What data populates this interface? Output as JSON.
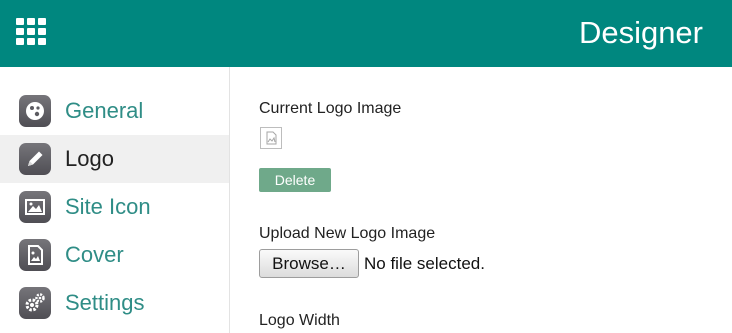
{
  "header": {
    "title": "Designer",
    "menu_icon": "grid-apps-icon",
    "color": "#00877f"
  },
  "sidebar": {
    "items": [
      {
        "label": "General",
        "icon": "palette-icon"
      },
      {
        "label": "Logo",
        "icon": "pencil-icon",
        "active": true
      },
      {
        "label": "Site Icon",
        "icon": "image-icon"
      },
      {
        "label": "Cover",
        "icon": "document-image-icon"
      },
      {
        "label": "Settings",
        "icon": "gears-icon"
      }
    ],
    "link_color": "#2f8d86"
  },
  "main": {
    "current_logo_label": "Current Logo Image",
    "delete_label": "Delete",
    "upload_label": "Upload New Logo Image",
    "browse_label": "Browse…",
    "file_status": "No file selected.",
    "logo_width_label": "Logo Width"
  }
}
